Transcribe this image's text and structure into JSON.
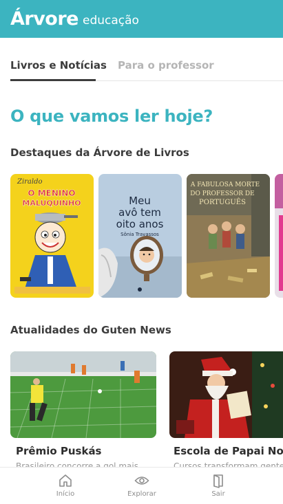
{
  "header": {
    "brand": "Árvore",
    "brand_sub": "educação"
  },
  "tabs": [
    {
      "label": "Livros e Notícias",
      "active": true
    },
    {
      "label": "Para o professor",
      "active": false
    }
  ],
  "headline": "O que vamos ler hoje?",
  "books_section": {
    "title": "Destaques da Árvore de Livros",
    "books": [
      {
        "title_line1": "O MENINO",
        "title_line2": "MALUQUINHO",
        "author_signature": "Ziraldo",
        "color": "#f4d21c"
      },
      {
        "title_line1": "Meu",
        "title_line2": "avô tem",
        "title_line3": "oito anos",
        "author": "Sônia Travassos",
        "color": "#b9cde0"
      },
      {
        "title_line1": "A FABULOSA MORTE",
        "title_line2": "DO PROFESSOR DE",
        "title_line3": "PORTUGUÊS",
        "color": "#8e7a55"
      }
    ]
  },
  "news_section": {
    "title": "Atualidades do Guten News",
    "items": [
      {
        "title": "Prêmio Puskás",
        "snippet": "Brasileiro concorre a gol mais"
      },
      {
        "title": "Escola de Papai Noel",
        "snippet": "Cursos transformam gente"
      }
    ]
  },
  "bottom_nav": [
    {
      "label": "Início",
      "icon": "home-icon"
    },
    {
      "label": "Explorar",
      "icon": "eye-icon"
    },
    {
      "label": "Sair",
      "icon": "exit-icon"
    }
  ],
  "colors": {
    "brand": "#3cb4c0",
    "text": "#3c3c3c",
    "muted": "#b5b5b5"
  }
}
